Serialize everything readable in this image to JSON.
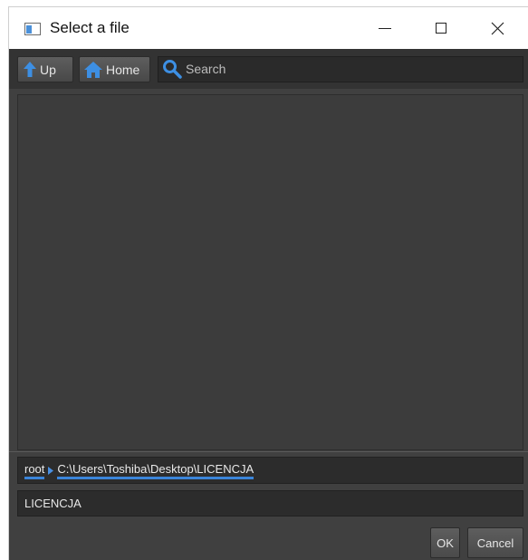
{
  "window": {
    "title": "Select a file"
  },
  "toolbar": {
    "up_label": "Up",
    "home_label": "Home",
    "search_placeholder": "Search"
  },
  "path": {
    "root_label": "root",
    "current_label": "C:\\Users\\Toshiba\\Desktop\\LICENCJA"
  },
  "filename": {
    "value": "LICENCJA"
  },
  "buttons": {
    "ok_label": "OK",
    "cancel_label": "Cancel"
  },
  "colors": {
    "accent": "#3b85d9",
    "panel": "#404040",
    "field": "#2c2c2c"
  },
  "icons": {
    "up": "arrow-up-icon",
    "home": "home-icon",
    "search": "search-icon",
    "breadcrumb_separator": "chevron-right-icon"
  }
}
